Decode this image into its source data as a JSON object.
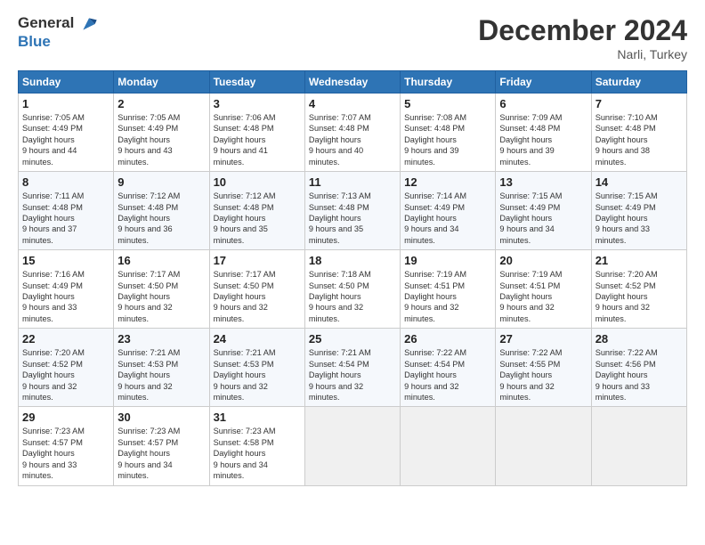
{
  "logo": {
    "line1": "General",
    "line2": "Blue"
  },
  "title": "December 2024",
  "location": "Narli, Turkey",
  "days_of_week": [
    "Sunday",
    "Monday",
    "Tuesday",
    "Wednesday",
    "Thursday",
    "Friday",
    "Saturday"
  ],
  "weeks": [
    [
      {
        "day": 1,
        "sunrise": "7:05 AM",
        "sunset": "4:49 PM",
        "daylight": "9 hours and 44 minutes."
      },
      {
        "day": 2,
        "sunrise": "7:05 AM",
        "sunset": "4:49 PM",
        "daylight": "9 hours and 43 minutes."
      },
      {
        "day": 3,
        "sunrise": "7:06 AM",
        "sunset": "4:48 PM",
        "daylight": "9 hours and 41 minutes."
      },
      {
        "day": 4,
        "sunrise": "7:07 AM",
        "sunset": "4:48 PM",
        "daylight": "9 hours and 40 minutes."
      },
      {
        "day": 5,
        "sunrise": "7:08 AM",
        "sunset": "4:48 PM",
        "daylight": "9 hours and 39 minutes."
      },
      {
        "day": 6,
        "sunrise": "7:09 AM",
        "sunset": "4:48 PM",
        "daylight": "9 hours and 39 minutes."
      },
      {
        "day": 7,
        "sunrise": "7:10 AM",
        "sunset": "4:48 PM",
        "daylight": "9 hours and 38 minutes."
      }
    ],
    [
      {
        "day": 8,
        "sunrise": "7:11 AM",
        "sunset": "4:48 PM",
        "daylight": "9 hours and 37 minutes."
      },
      {
        "day": 9,
        "sunrise": "7:12 AM",
        "sunset": "4:48 PM",
        "daylight": "9 hours and 36 minutes."
      },
      {
        "day": 10,
        "sunrise": "7:12 AM",
        "sunset": "4:48 PM",
        "daylight": "9 hours and 35 minutes."
      },
      {
        "day": 11,
        "sunrise": "7:13 AM",
        "sunset": "4:48 PM",
        "daylight": "9 hours and 35 minutes."
      },
      {
        "day": 12,
        "sunrise": "7:14 AM",
        "sunset": "4:49 PM",
        "daylight": "9 hours and 34 minutes."
      },
      {
        "day": 13,
        "sunrise": "7:15 AM",
        "sunset": "4:49 PM",
        "daylight": "9 hours and 34 minutes."
      },
      {
        "day": 14,
        "sunrise": "7:15 AM",
        "sunset": "4:49 PM",
        "daylight": "9 hours and 33 minutes."
      }
    ],
    [
      {
        "day": 15,
        "sunrise": "7:16 AM",
        "sunset": "4:49 PM",
        "daylight": "9 hours and 33 minutes."
      },
      {
        "day": 16,
        "sunrise": "7:17 AM",
        "sunset": "4:50 PM",
        "daylight": "9 hours and 32 minutes."
      },
      {
        "day": 17,
        "sunrise": "7:17 AM",
        "sunset": "4:50 PM",
        "daylight": "9 hours and 32 minutes."
      },
      {
        "day": 18,
        "sunrise": "7:18 AM",
        "sunset": "4:50 PM",
        "daylight": "9 hours and 32 minutes."
      },
      {
        "day": 19,
        "sunrise": "7:19 AM",
        "sunset": "4:51 PM",
        "daylight": "9 hours and 32 minutes."
      },
      {
        "day": 20,
        "sunrise": "7:19 AM",
        "sunset": "4:51 PM",
        "daylight": "9 hours and 32 minutes."
      },
      {
        "day": 21,
        "sunrise": "7:20 AM",
        "sunset": "4:52 PM",
        "daylight": "9 hours and 32 minutes."
      }
    ],
    [
      {
        "day": 22,
        "sunrise": "7:20 AM",
        "sunset": "4:52 PM",
        "daylight": "9 hours and 32 minutes."
      },
      {
        "day": 23,
        "sunrise": "7:21 AM",
        "sunset": "4:53 PM",
        "daylight": "9 hours and 32 minutes."
      },
      {
        "day": 24,
        "sunrise": "7:21 AM",
        "sunset": "4:53 PM",
        "daylight": "9 hours and 32 minutes."
      },
      {
        "day": 25,
        "sunrise": "7:21 AM",
        "sunset": "4:54 PM",
        "daylight": "9 hours and 32 minutes."
      },
      {
        "day": 26,
        "sunrise": "7:22 AM",
        "sunset": "4:54 PM",
        "daylight": "9 hours and 32 minutes."
      },
      {
        "day": 27,
        "sunrise": "7:22 AM",
        "sunset": "4:55 PM",
        "daylight": "9 hours and 32 minutes."
      },
      {
        "day": 28,
        "sunrise": "7:22 AM",
        "sunset": "4:56 PM",
        "daylight": "9 hours and 33 minutes."
      }
    ],
    [
      {
        "day": 29,
        "sunrise": "7:23 AM",
        "sunset": "4:57 PM",
        "daylight": "9 hours and 33 minutes."
      },
      {
        "day": 30,
        "sunrise": "7:23 AM",
        "sunset": "4:57 PM",
        "daylight": "9 hours and 34 minutes."
      },
      {
        "day": 31,
        "sunrise": "7:23 AM",
        "sunset": "4:58 PM",
        "daylight": "9 hours and 34 minutes."
      },
      null,
      null,
      null,
      null
    ]
  ]
}
